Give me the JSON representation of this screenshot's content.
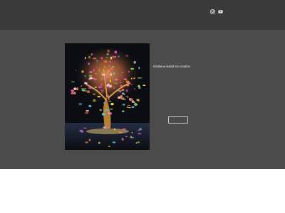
{
  "header": {
    "social_icons": [
      "instagram-icon",
      "youtube-icon"
    ]
  },
  "main": {
    "caption": "Intuitiana duhuli sin creatios",
    "button_label": ""
  },
  "colors": {
    "header_bg": "#3a3a3a",
    "main_bg": "#4b4b4b",
    "footer_bg": "#ffffff",
    "text": "#f2f2f2"
  }
}
